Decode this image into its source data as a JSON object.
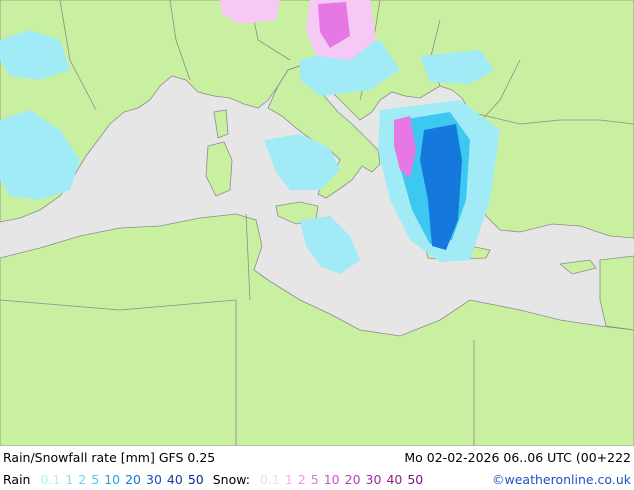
{
  "map": {
    "colors": {
      "sea": "#e6e6e6",
      "land": "#c8f0a0",
      "border": "#8c8c8c",
      "rain_light": "#a0ebf5",
      "rain_mid": "#3cc8f0",
      "rain_heavy": "#1478dc",
      "snow_light": "#f5c8f5",
      "snow_mid": "#e678e6"
    }
  },
  "footer": {
    "title": "Rain/Snowfall rate [mm] GFS 0.25",
    "datetime": "Mo 02-02-2026 06..06 UTC (00+222",
    "rain_label": "Rain",
    "rain_scale": [
      {
        "text": "0.1",
        "color": "#b4f0fa"
      },
      {
        "text": "1",
        "color": "#96dcf0"
      },
      {
        "text": "2",
        "color": "#78d2f0"
      },
      {
        "text": "5",
        "color": "#50c8f0"
      },
      {
        "text": "10",
        "color": "#28a0e6"
      },
      {
        "text": "20",
        "color": "#1478dc"
      },
      {
        "text": "30",
        "color": "#1450be"
      },
      {
        "text": "40",
        "color": "#143ca0"
      },
      {
        "text": "50",
        "color": "#0a2882"
      }
    ],
    "snow_label": "Snow:",
    "snow_scale": [
      {
        "text": "0.1",
        "color": "#f0dcf0"
      },
      {
        "text": "1",
        "color": "#f0b4f0"
      },
      {
        "text": "2",
        "color": "#e696e6"
      },
      {
        "text": "5",
        "color": "#dc78dc"
      },
      {
        "text": "10",
        "color": "#d250d2"
      },
      {
        "text": "20",
        "color": "#be3cbe"
      },
      {
        "text": "30",
        "color": "#a028a0"
      },
      {
        "text": "40",
        "color": "#8c1e8c"
      },
      {
        "text": "50",
        "color": "#781478"
      }
    ],
    "credit": "©weatheronline.co.uk"
  }
}
